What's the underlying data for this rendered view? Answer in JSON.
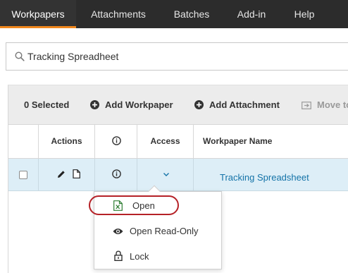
{
  "nav": {
    "tabs": [
      {
        "label": "Workpapers",
        "active": true
      },
      {
        "label": "Attachments"
      },
      {
        "label": "Batches"
      },
      {
        "label": "Add-in"
      },
      {
        "label": "Help"
      }
    ]
  },
  "search": {
    "value": "Tracking Spreadheet"
  },
  "toolbar": {
    "selected": "0 Selected",
    "add_workpaper": "Add Workpaper",
    "add_attachment": "Add Attachment",
    "move_to": "Move to"
  },
  "table": {
    "headers": {
      "actions": "Actions",
      "access": "Access",
      "name": "Workpaper Name"
    },
    "rows": [
      {
        "name": "Tracking Spreadsheet"
      }
    ]
  },
  "access_menu": {
    "items": [
      {
        "label": "Open",
        "icon": "excel-icon"
      },
      {
        "label": "Open Read-Only",
        "icon": "eye-icon"
      },
      {
        "label": "Lock",
        "icon": "lock-icon"
      }
    ]
  },
  "colors": {
    "accent": "#f0871d",
    "link": "#1473a8",
    "row_highlight": "#ddeef7",
    "annotation": "#b52127"
  }
}
